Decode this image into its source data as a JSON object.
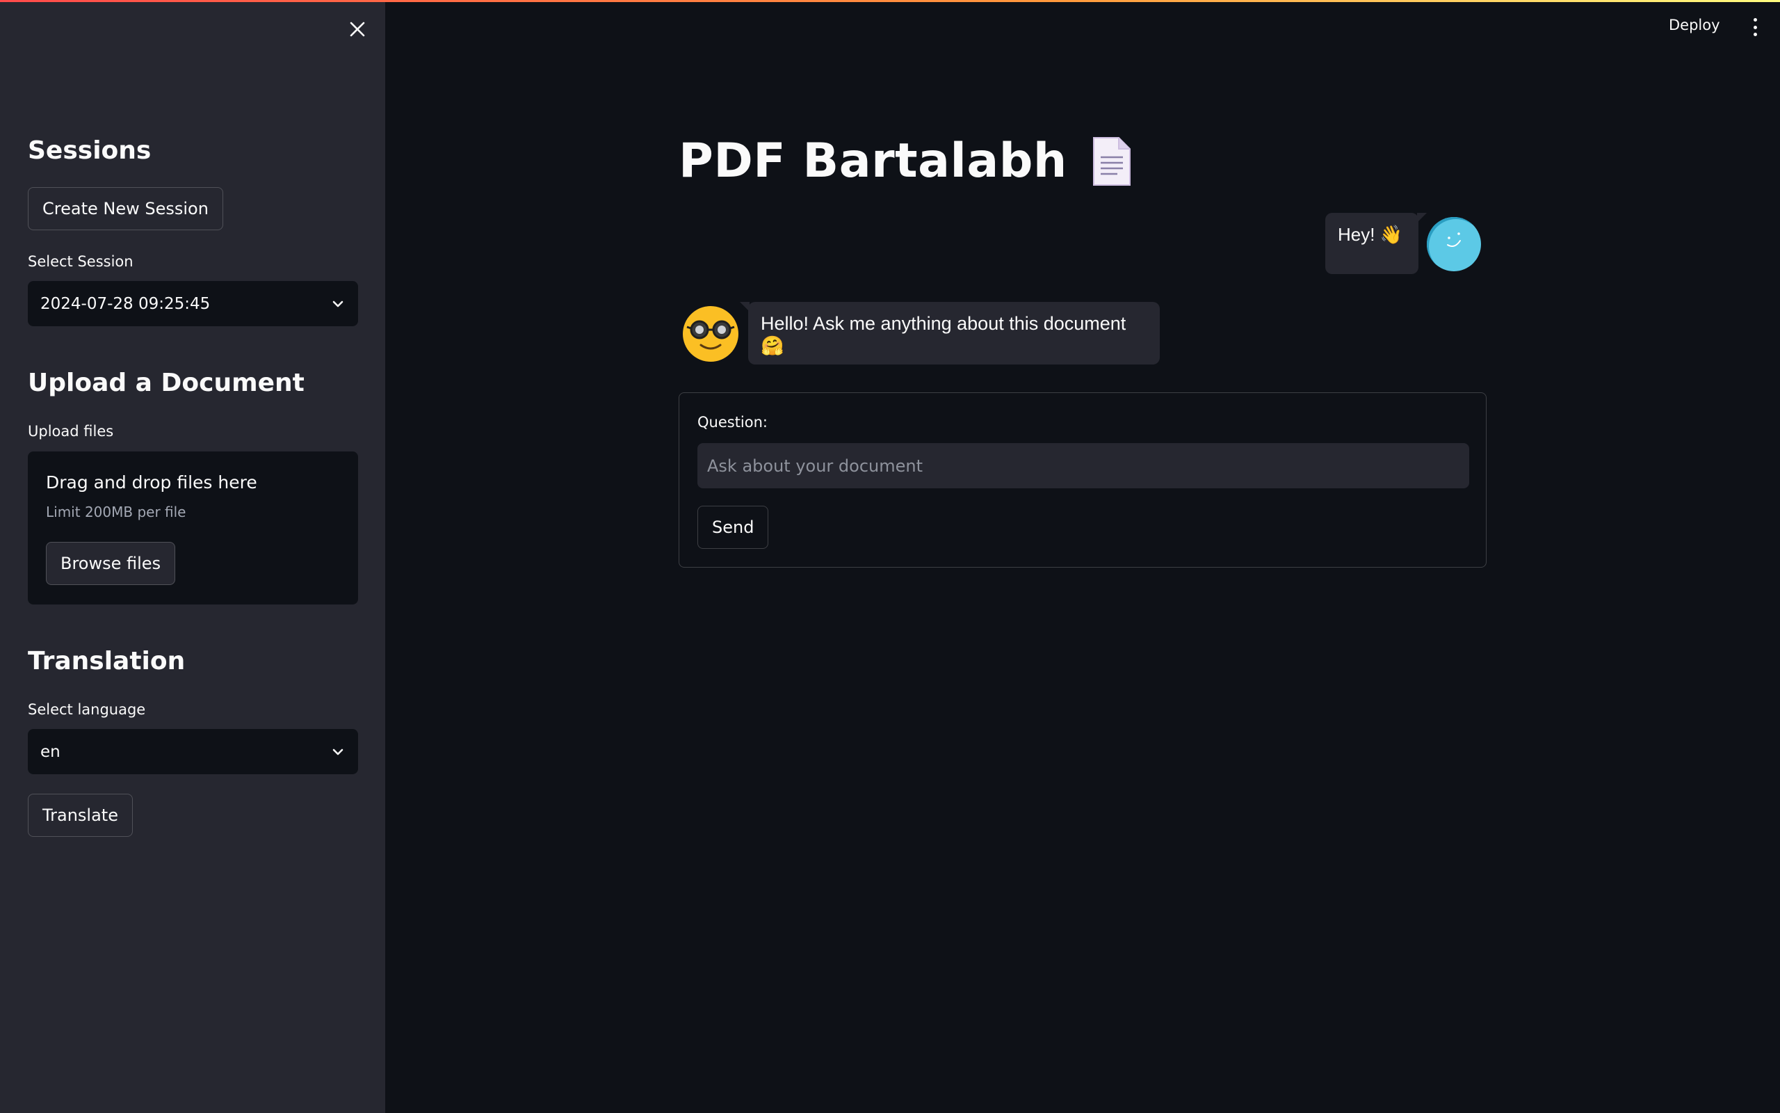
{
  "sidebar": {
    "sessions_heading": "Sessions",
    "create_session_label": "Create New Session",
    "select_session_label": "Select Session",
    "selected_session": "2024-07-28 09:25:45",
    "upload_heading": "Upload a Document",
    "upload_label": "Upload files",
    "dropzone_text": "Drag and drop files here",
    "dropzone_limit": "Limit 200MB per file",
    "browse_label": "Browse files",
    "translation_heading": "Translation",
    "select_language_label": "Select language",
    "selected_language": "en",
    "translate_label": "Translate"
  },
  "header": {
    "deploy_label": "Deploy"
  },
  "main": {
    "title": "PDF Bartalabh",
    "messages": [
      {
        "role": "user",
        "text": "Hey! 👋"
      },
      {
        "role": "assistant",
        "text": "Hello! Ask me anything about this document 🤗"
      }
    ],
    "question_label": "Question:",
    "question_placeholder": "Ask about your document",
    "question_value": "",
    "send_label": "Send"
  },
  "colors": {
    "background": "#0e1117",
    "sidebar": "#262730",
    "accent": "#ff4b4b",
    "user_avatar": "#5cc9e6",
    "bot_avatar": "#fbbf24"
  }
}
